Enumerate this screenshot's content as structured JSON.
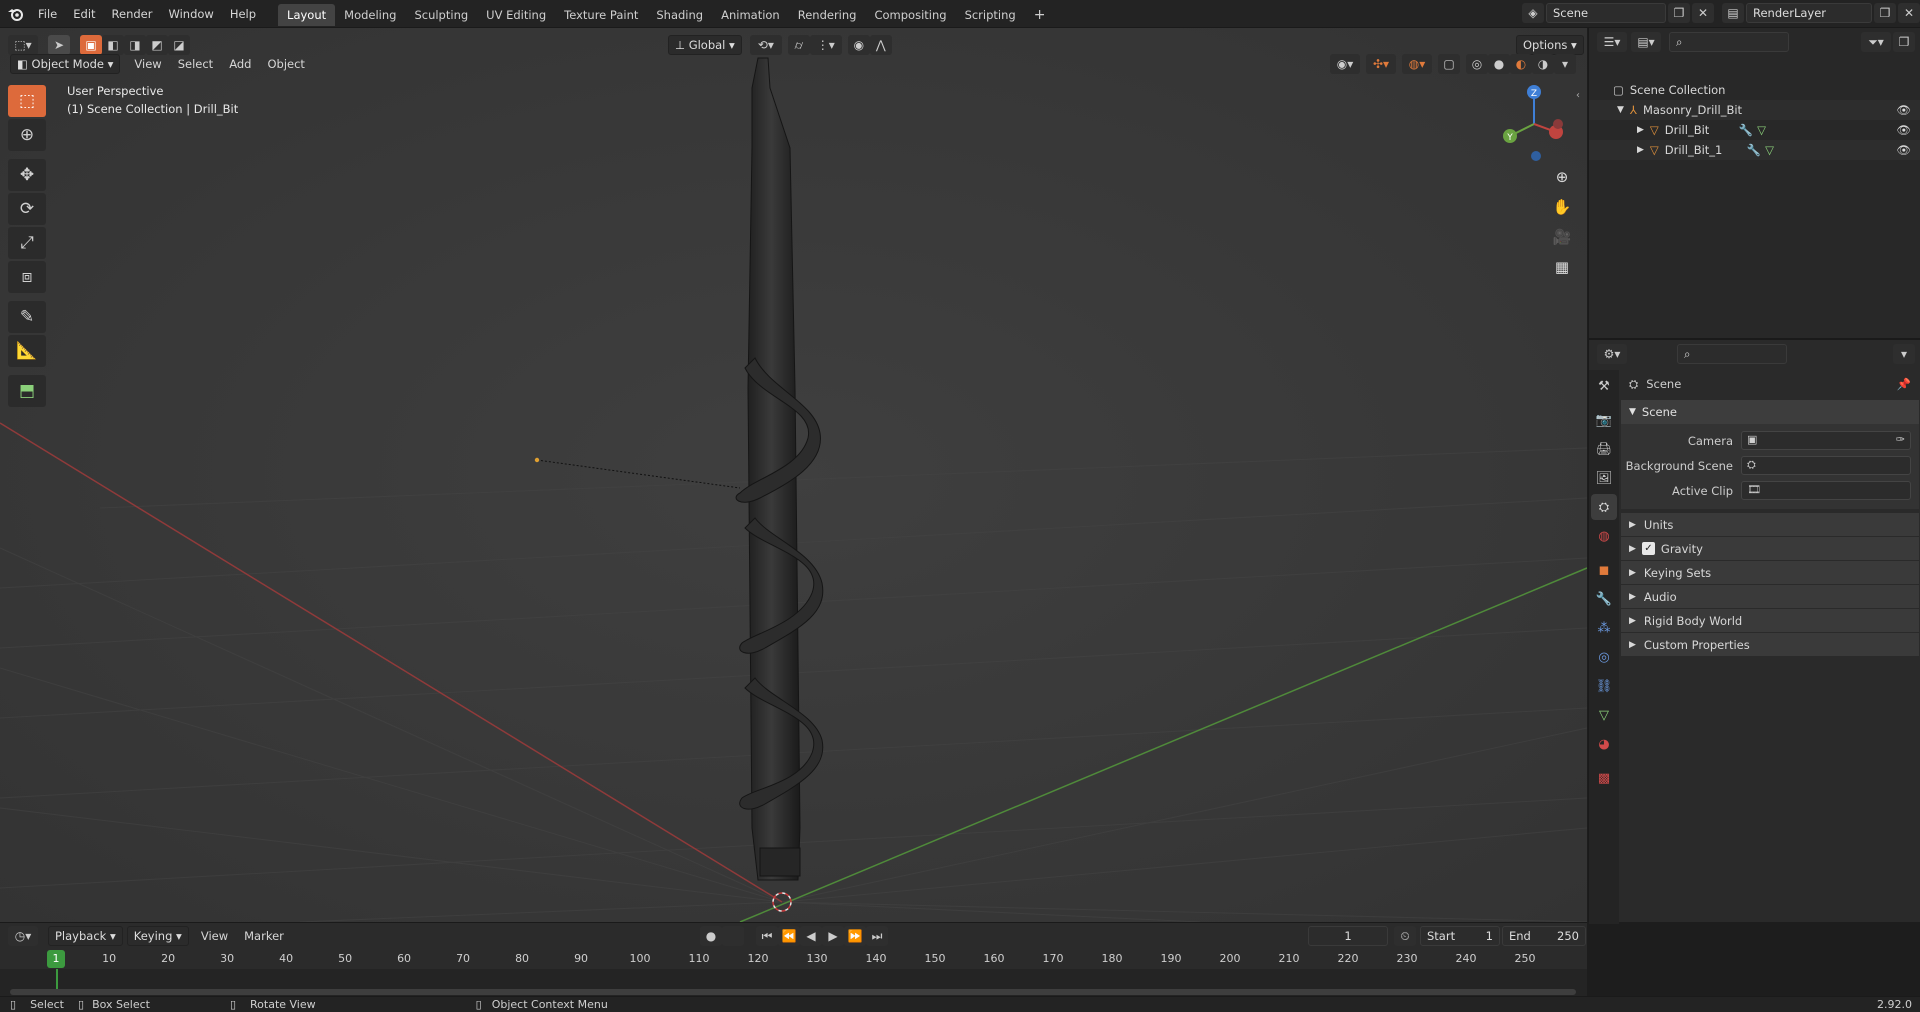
{
  "topbar": {
    "menus": [
      "File",
      "Edit",
      "Render",
      "Window",
      "Help"
    ],
    "workspaces": [
      "Layout",
      "Modeling",
      "Sculpting",
      "UV Editing",
      "Texture Paint",
      "Shading",
      "Animation",
      "Rendering",
      "Compositing",
      "Scripting"
    ],
    "active_workspace": "Layout",
    "add_tab": "+",
    "scene_name": "Scene",
    "view_layer": "RenderLayer"
  },
  "viewport": {
    "mode": "Object Mode",
    "menus": [
      "View",
      "Select",
      "Add",
      "Object"
    ],
    "transform_orientation": "Global",
    "options_label": "Options",
    "overlay_line1": "User Perspective",
    "overlay_line2": "(1) Scene Collection | Drill_Bit",
    "gizmo": {
      "z": "Z",
      "y": "Y"
    }
  },
  "outliner": {
    "root": "Scene Collection",
    "collection": "Masonry_Drill_Bit",
    "objects": [
      "Drill_Bit",
      "Drill_Bit_1"
    ]
  },
  "properties": {
    "breadcrumb": "Scene",
    "panel_title": "Scene",
    "fields": [
      {
        "label": "Camera"
      },
      {
        "label": "Background Scene"
      },
      {
        "label": "Active Clip"
      }
    ],
    "subpanels": [
      "Units",
      "Gravity",
      "Keying Sets",
      "Audio",
      "Rigid Body World",
      "Custom Properties"
    ],
    "gravity_checked": true
  },
  "timeline": {
    "menus": [
      "Playback",
      "Keying",
      "View",
      "Marker"
    ],
    "current_frame": "1",
    "start_label": "Start",
    "start": "1",
    "end_label": "End",
    "end": "250",
    "ruler": [
      "1",
      "10",
      "20",
      "30",
      "40",
      "50",
      "60",
      "70",
      "80",
      "90",
      "100",
      "110",
      "120",
      "130",
      "140",
      "150",
      "160",
      "170",
      "180",
      "190",
      "200",
      "210",
      "220",
      "230",
      "240",
      "250"
    ]
  },
  "statusbar": {
    "select": "Select",
    "box_select": "Box Select",
    "rotate_view": "Rotate View",
    "context_menu": "Object Context Menu",
    "version": "2.92.0"
  },
  "colors": {
    "accent": "#e07a3b",
    "axis_x": "#c0443f",
    "axis_y": "#6aa341",
    "axis_z": "#3f7fd6",
    "playhead": "#3c9a3f"
  }
}
